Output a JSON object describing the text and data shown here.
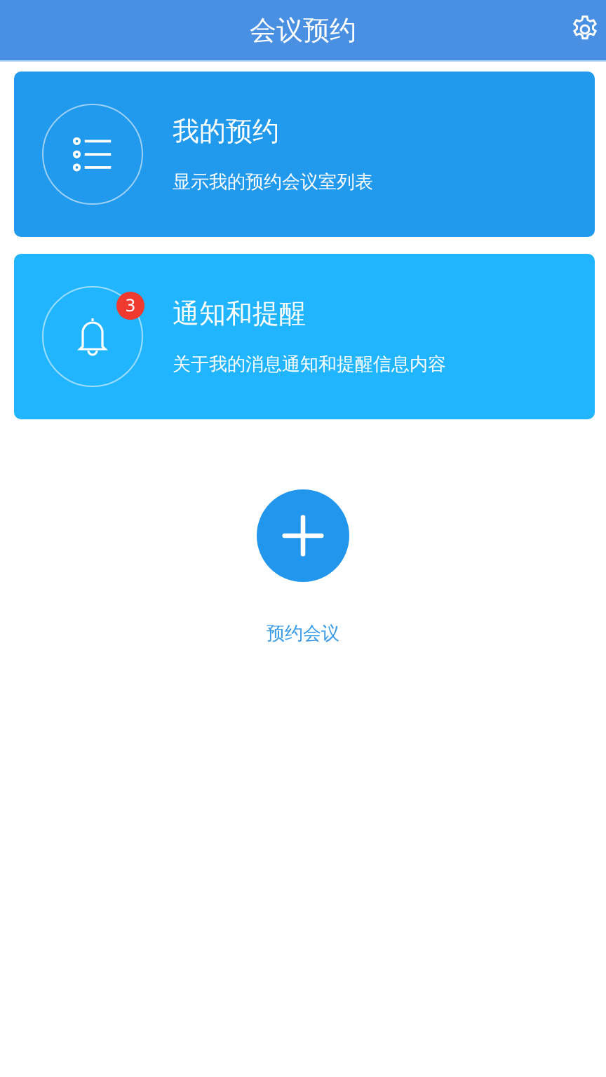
{
  "header": {
    "title": "会议预约"
  },
  "cards": [
    {
      "kind": "list",
      "title": "我的预约",
      "subtitle": "显示我的预约会议室列表",
      "color": "#2199ec"
    },
    {
      "kind": "bell",
      "title": "通知和提醒",
      "subtitle": "关于我的消息通知和提醒信息内容",
      "color": "#22b5ff",
      "badge": "3"
    }
  ],
  "action": {
    "label": "预约会议"
  }
}
